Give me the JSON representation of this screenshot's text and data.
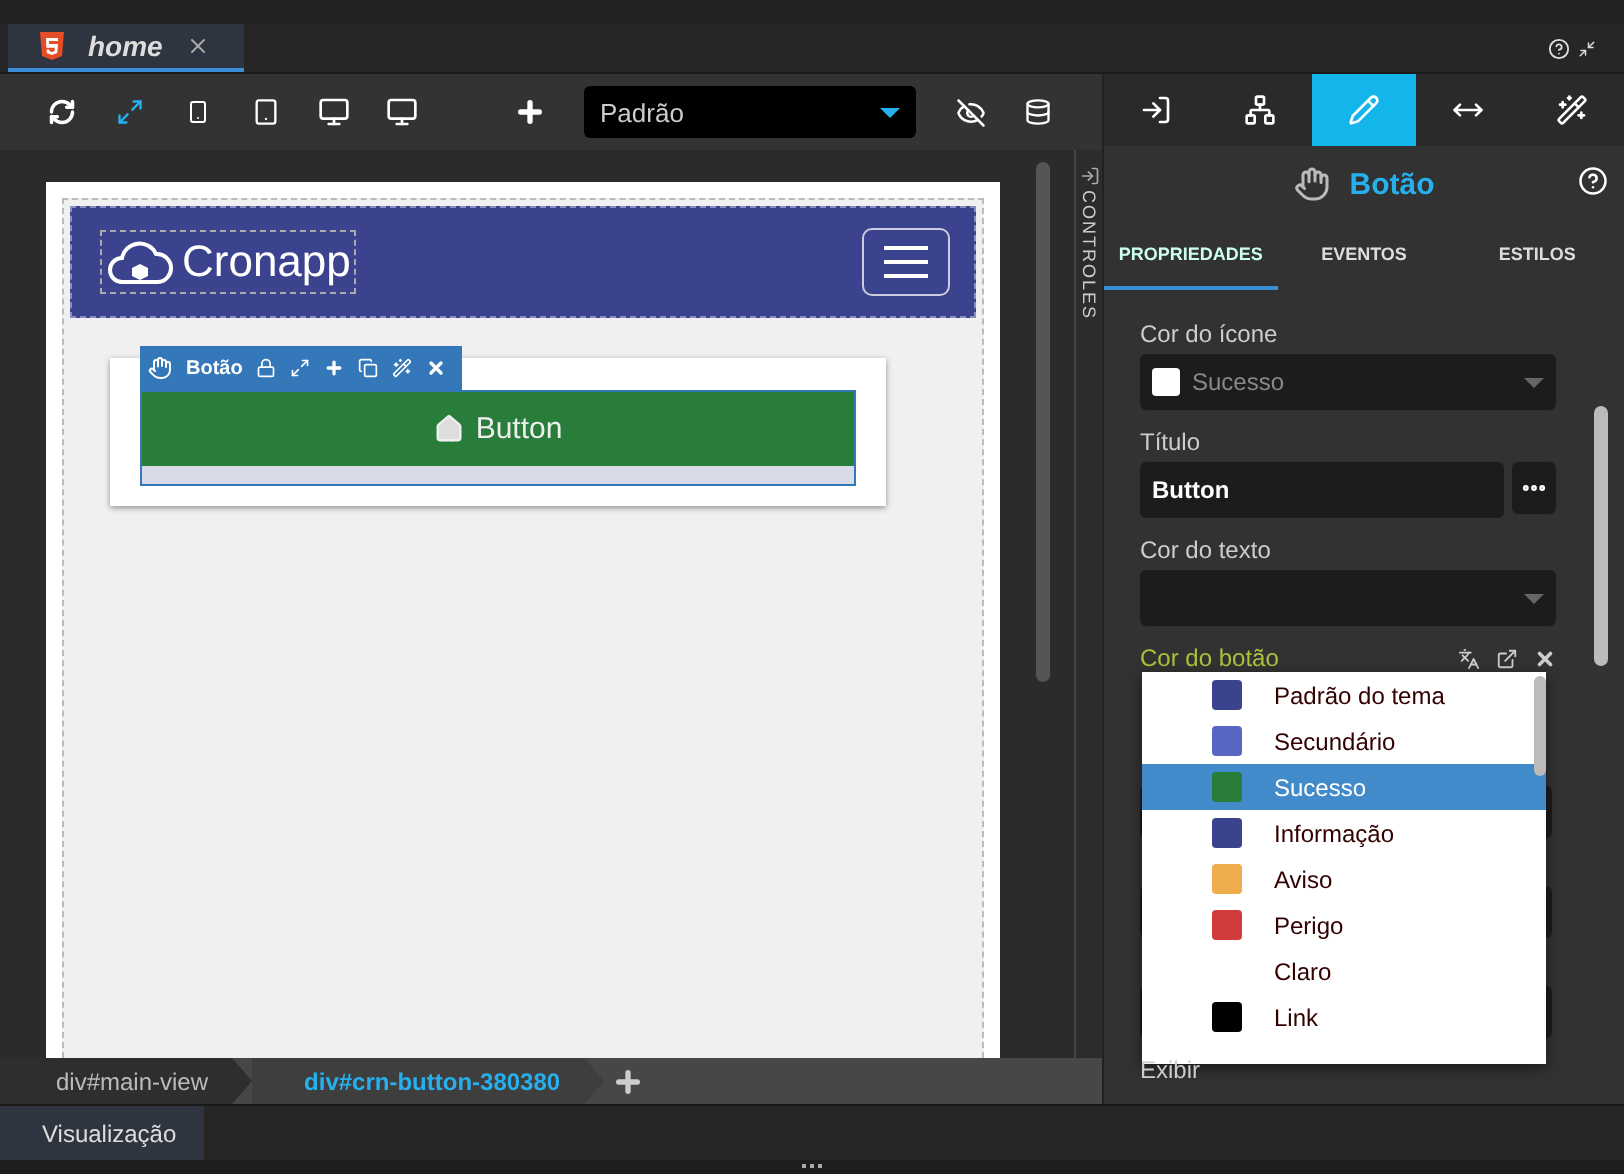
{
  "editor_tabs": [
    {
      "label": "home",
      "selected": true
    }
  ],
  "toolbar": {
    "theme_select": "Padrão"
  },
  "canvas": {
    "brand": "Cronapp",
    "component_toolbar": {
      "label": "Botão"
    },
    "button": {
      "label": "Button"
    }
  },
  "side_tabs": [
    {
      "label": "CONTROLES"
    }
  ],
  "breadcrumb": [
    {
      "label": "div#main-view",
      "selected": false
    },
    {
      "label": "div#crn-button-380380",
      "selected": true
    }
  ],
  "bottom_tabs": [
    {
      "label": "Visualização",
      "selected": true
    }
  ],
  "inspector": {
    "tool_tabs": [
      {
        "kind": "enter",
        "selected": false
      },
      {
        "kind": "tree",
        "selected": false
      },
      {
        "kind": "pencil",
        "selected": true
      },
      {
        "kind": "resize",
        "selected": false
      },
      {
        "kind": "magic",
        "selected": false
      }
    ],
    "title": "Botão",
    "tabs": [
      {
        "label": "PROPRIEDADES",
        "selected": true
      },
      {
        "label": "EVENTOS",
        "selected": false
      },
      {
        "label": "ESTILOS",
        "selected": false
      }
    ],
    "fields": [
      {
        "kind": "color-select",
        "label": "Cor do ícone",
        "value": "Sucesso",
        "color": "#ffffff",
        "active": false
      },
      {
        "kind": "text",
        "label": "Título",
        "value": "Button",
        "active": false
      },
      {
        "kind": "select",
        "label": "Cor do texto",
        "active": false
      },
      {
        "kind": "color-select",
        "label": "Cor do botão",
        "active": true,
        "open": true
      }
    ],
    "dropdown": [
      {
        "label": "Padrão do tema",
        "color": "#3c438e",
        "selected": false
      },
      {
        "label": "Secundário",
        "color": "#5a67c2",
        "selected": false
      },
      {
        "label": "Sucesso",
        "color": "#287d3a",
        "selected": true
      },
      {
        "label": "Informação",
        "color": "#3c438e",
        "selected": false
      },
      {
        "label": "Aviso",
        "color": "#f0ad4e",
        "selected": false
      },
      {
        "label": "Perigo",
        "color": "#d13b3b",
        "selected": false
      },
      {
        "label": "Claro",
        "selected": false
      },
      {
        "label": "Link",
        "color": "#000000",
        "selected": false
      }
    ],
    "footer_label": "Exibir"
  }
}
